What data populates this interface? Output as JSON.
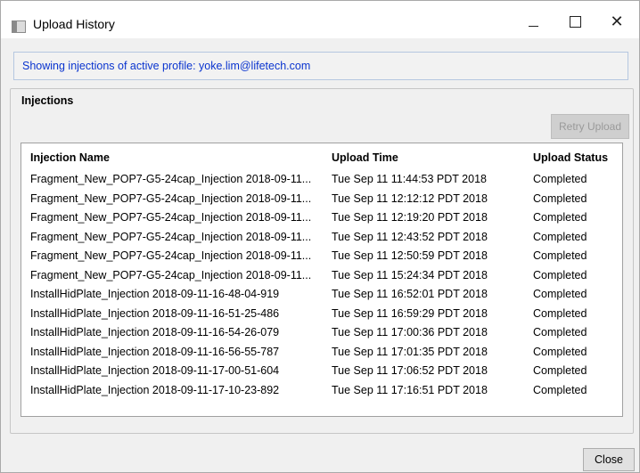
{
  "window": {
    "title": "Upload History"
  },
  "profile": {
    "text": "Showing injections of active profile: yoke.lim@lifetech.com"
  },
  "injections": {
    "group_title": "Injections",
    "retry_label": "Retry Upload",
    "columns": [
      "Injection Name",
      "Upload Time",
      "Upload Status"
    ],
    "rows": [
      [
        "Fragment_New_POP7-G5-24cap_Injection 2018-09-11...",
        "Tue Sep 11 11:44:53 PDT 2018",
        "Completed"
      ],
      [
        "Fragment_New_POP7-G5-24cap_Injection 2018-09-11...",
        "Tue Sep 11 12:12:12 PDT 2018",
        "Completed"
      ],
      [
        "Fragment_New_POP7-G5-24cap_Injection 2018-09-11...",
        "Tue Sep 11 12:19:20 PDT 2018",
        "Completed"
      ],
      [
        "Fragment_New_POP7-G5-24cap_Injection 2018-09-11...",
        "Tue Sep 11 12:43:52 PDT 2018",
        "Completed"
      ],
      [
        "Fragment_New_POP7-G5-24cap_Injection 2018-09-11...",
        "Tue Sep 11 12:50:59 PDT 2018",
        "Completed"
      ],
      [
        "Fragment_New_POP7-G5-24cap_Injection 2018-09-11...",
        "Tue Sep 11 15:24:34 PDT 2018",
        "Completed"
      ],
      [
        "InstallHidPlate_Injection 2018-09-11-16-48-04-919",
        "Tue Sep 11 16:52:01 PDT 2018",
        "Completed"
      ],
      [
        "InstallHidPlate_Injection 2018-09-11-16-51-25-486",
        "Tue Sep 11 16:59:29 PDT 2018",
        "Completed"
      ],
      [
        "InstallHidPlate_Injection 2018-09-11-16-54-26-079",
        "Tue Sep 11 17:00:36 PDT 2018",
        "Completed"
      ],
      [
        "InstallHidPlate_Injection 2018-09-11-16-56-55-787",
        "Tue Sep 11 17:01:35 PDT 2018",
        "Completed"
      ],
      [
        "InstallHidPlate_Injection 2018-09-11-17-00-51-604",
        "Tue Sep 11 17:06:52 PDT 2018",
        "Completed"
      ],
      [
        "InstallHidPlate_Injection 2018-09-11-17-10-23-892",
        "Tue Sep 11 17:16:51 PDT 2018",
        "Completed"
      ]
    ]
  },
  "footer": {
    "close_label": "Close"
  },
  "colors": {
    "profile_text": "#0a34cf"
  }
}
